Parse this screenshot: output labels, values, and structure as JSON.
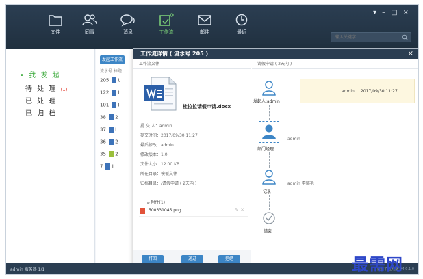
{
  "nav": {
    "items": [
      {
        "label": "文件",
        "icon": "folder-icon"
      },
      {
        "label": "同事",
        "icon": "people-icon"
      },
      {
        "label": "消息",
        "icon": "chat-icon"
      },
      {
        "label": "工作流",
        "icon": "workflow-icon"
      },
      {
        "label": "邮件",
        "icon": "mail-icon"
      },
      {
        "label": "最近",
        "icon": "clock-icon"
      }
    ],
    "active_index": 3
  },
  "window_controls": {
    "min": "▾",
    "restore": "–",
    "max": "□",
    "close": "×"
  },
  "search": {
    "placeholder": "输入关键字"
  },
  "sidebar": {
    "items": [
      {
        "label": "• 我 发 起",
        "badge": ""
      },
      {
        "label": "待 处 理",
        "badge": "(1)"
      },
      {
        "label": "已 处 理",
        "badge": ""
      },
      {
        "label": "已 归 档",
        "badge": ""
      }
    ]
  },
  "list": {
    "start_button": "发起工作流",
    "headers": [
      "流水号",
      "标题"
    ],
    "rows": [
      {
        "no": "205",
        "t": "t",
        "type": "doc"
      },
      {
        "no": "122",
        "t": "I",
        "type": "doc"
      },
      {
        "no": "101",
        "t": "I",
        "type": "doc"
      },
      {
        "no": "38",
        "t": "2",
        "type": "doc"
      },
      {
        "no": "37",
        "t": "I",
        "type": "doc"
      },
      {
        "no": "36",
        "t": "2",
        "type": "doc"
      },
      {
        "no": "35",
        "t": "2",
        "type": "img"
      },
      {
        "no": "7",
        "t": "I",
        "type": "doc"
      }
    ]
  },
  "modal": {
    "title": "工作流详情 ( 流水号 205 )",
    "close": "×",
    "left_header": "工作流文件",
    "file_name": "杜拉拉请假申请.docx",
    "meta": [
      "提 交 人：admin",
      "提交时间：2017/09/30 11:27",
      "最后修改：admin",
      "修改版本：1.0",
      "文件大小：12.00 KB",
      "所在目录：模板文件",
      "归档目录：/请假申请 ( 2天内 )"
    ],
    "attachments_label": "附件(1)",
    "attachment": "500331045.png",
    "attachment_actions": "✎ ✕",
    "buttons": [
      "打回",
      "通过",
      "拒绝"
    ],
    "right_header": "请假申请 ( 2天内 )",
    "flow": {
      "initiator_label": "发起人:admin",
      "comment_user": "admin",
      "comment_time": "2017/09/30 11:27",
      "dept_label": "部门经理",
      "dept_user": "admin",
      "record_label": "记录",
      "record_users": "admin  李郁艳",
      "end_label": "结束"
    }
  },
  "status": {
    "left": "admin  服务器 1/1",
    "version": "云盒子 在线版 V4.0.1.0"
  },
  "watermark": "最需网"
}
